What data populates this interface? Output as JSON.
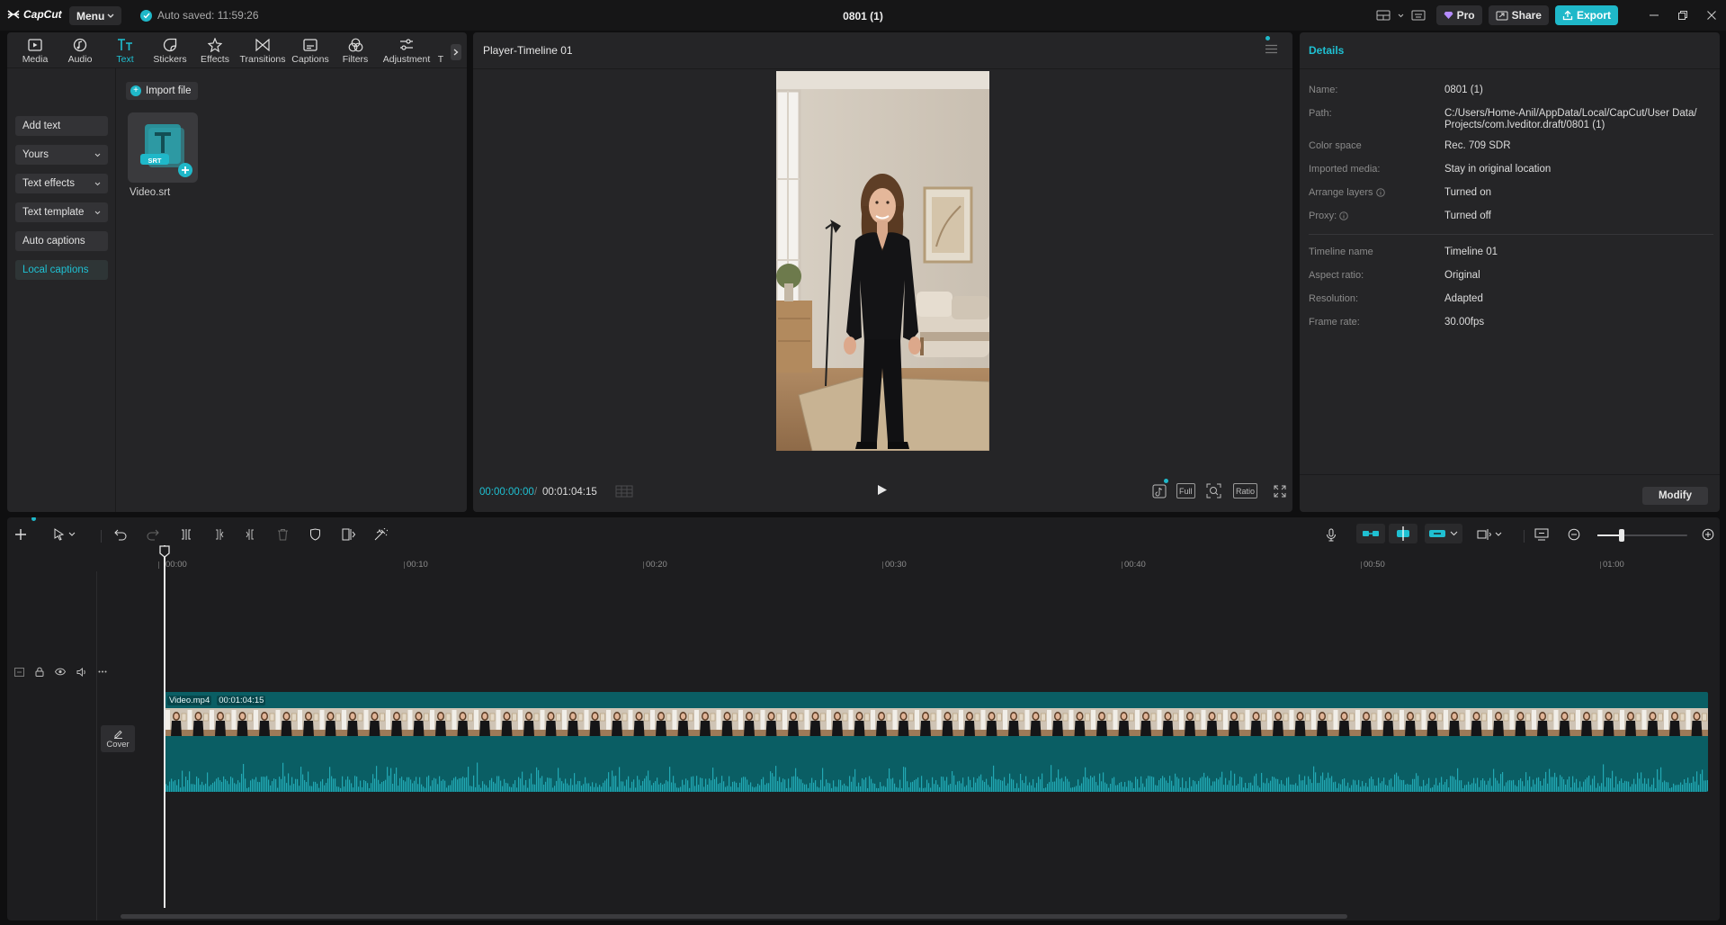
{
  "titlebar": {
    "logo": "CapCut",
    "menu_label": "Menu",
    "autosave": "Auto saved: 11:59:26",
    "project_title": "0801 (1)",
    "pro_label": "Pro",
    "share_label": "Share",
    "export_label": "Export"
  },
  "toolbar": {
    "tabs": [
      {
        "label": "Media",
        "icon": "media-icon"
      },
      {
        "label": "Audio",
        "icon": "audio-icon"
      },
      {
        "label": "Text",
        "icon": "text-icon"
      },
      {
        "label": "Stickers",
        "icon": "stickers-icon"
      },
      {
        "label": "Effects",
        "icon": "effects-icon"
      },
      {
        "label": "Transitions",
        "icon": "transitions-icon"
      },
      {
        "label": "Captions",
        "icon": "captions-icon"
      },
      {
        "label": "Filters",
        "icon": "filters-icon"
      },
      {
        "label": "Adjustment",
        "icon": "adjustment-icon"
      },
      {
        "label": "T",
        "icon": "templates-icon"
      }
    ],
    "active_tab": "Text"
  },
  "text_nav": {
    "items": [
      {
        "label": "Add text"
      },
      {
        "label": "Yours"
      },
      {
        "label": "Text effects"
      },
      {
        "label": "Text template"
      },
      {
        "label": "Auto captions"
      },
      {
        "label": "Local captions"
      }
    ]
  },
  "text_content": {
    "import_label": "Import file",
    "file_name": "Video.srt",
    "file_badge": "SRT"
  },
  "player": {
    "title": "Player-Timeline 01",
    "current_time": "00:00:00:00",
    "separator": "/",
    "duration": "00:01:04:15",
    "full_label": "Full",
    "ratio_label": "Ratio"
  },
  "details": {
    "title": "Details",
    "rows": [
      {
        "key": "Name:",
        "value": "0801 (1)"
      },
      {
        "key": "Path:",
        "value": "C:/Users/Home-Anil/AppData/Local/CapCut/User Data/ Projects/com.lveditor.draft/0801 (1)"
      },
      {
        "key": "Color space",
        "value": "Rec. 709 SDR"
      },
      {
        "key": "Imported media:",
        "value": "Stay in original location"
      },
      {
        "key": "Arrange layers",
        "value": "Turned on"
      },
      {
        "key": "Proxy:",
        "value": "Turned off"
      },
      {
        "key": "Timeline name",
        "value": "Timeline 01"
      },
      {
        "key": "Aspect ratio:",
        "value": "Original"
      },
      {
        "key": "Resolution:",
        "value": "Adapted"
      },
      {
        "key": "Frame rate:",
        "value": "30.00fps"
      }
    ],
    "modify_label": "Modify"
  },
  "timeline": {
    "ruler_labels": [
      "00:00",
      "00:10",
      "00:20",
      "00:30",
      "00:40",
      "00:50",
      "01:00"
    ],
    "clip_name": "Video.mp4",
    "clip_duration": "00:01:04:15",
    "cover_label": "Cover",
    "zoom_level": 0.27
  },
  "colors": {
    "accent": "#1fb8c9",
    "clip": "#0a5e64"
  }
}
